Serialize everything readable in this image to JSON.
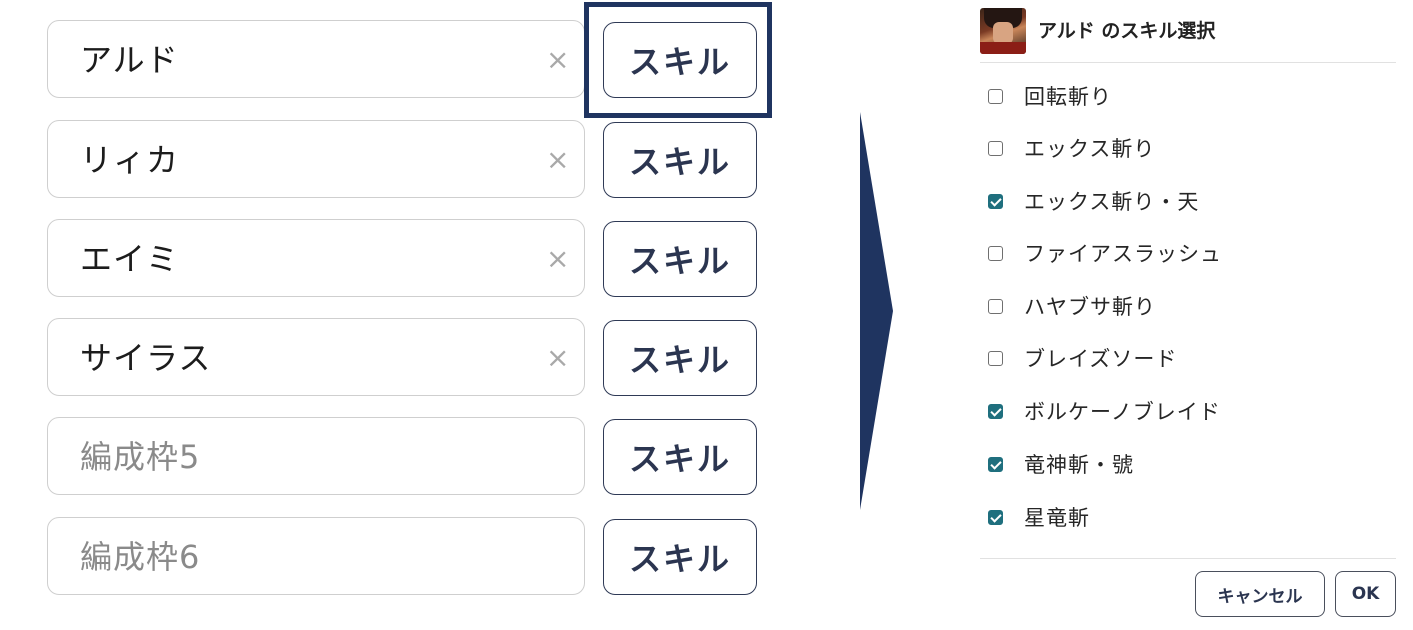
{
  "party": {
    "slots": [
      {
        "name": "アルド",
        "placeholder": false,
        "clearable": true
      },
      {
        "name": "リィカ",
        "placeholder": false,
        "clearable": true
      },
      {
        "name": "エイミ",
        "placeholder": false,
        "clearable": true
      },
      {
        "name": "サイラス",
        "placeholder": false,
        "clearable": true
      },
      {
        "name": "編成枠5",
        "placeholder": true,
        "clearable": false
      },
      {
        "name": "編成枠6",
        "placeholder": true,
        "clearable": false
      }
    ],
    "clear_icon": "×",
    "skill_button_label": "スキル",
    "highlighted_slot": 1
  },
  "dialog": {
    "title": "アルド のスキル選択",
    "skills": [
      {
        "label": "回転斬り",
        "checked": false
      },
      {
        "label": "エックス斬り",
        "checked": false
      },
      {
        "label": "エックス斬り・天",
        "checked": true
      },
      {
        "label": "ファイアスラッシュ",
        "checked": false
      },
      {
        "label": "ハヤブサ斬り",
        "checked": false
      },
      {
        "label": "ブレイズソード",
        "checked": false
      },
      {
        "label": "ボルケーノブレイド",
        "checked": true
      },
      {
        "label": "竜神斬・號",
        "checked": true
      },
      {
        "label": "星竜斬",
        "checked": true
      }
    ],
    "cancel_label": "キャンセル",
    "ok_label": "OK"
  },
  "colors": {
    "accent_navy": "#1f3460",
    "checkbox_checked": "#1f6f7e"
  }
}
